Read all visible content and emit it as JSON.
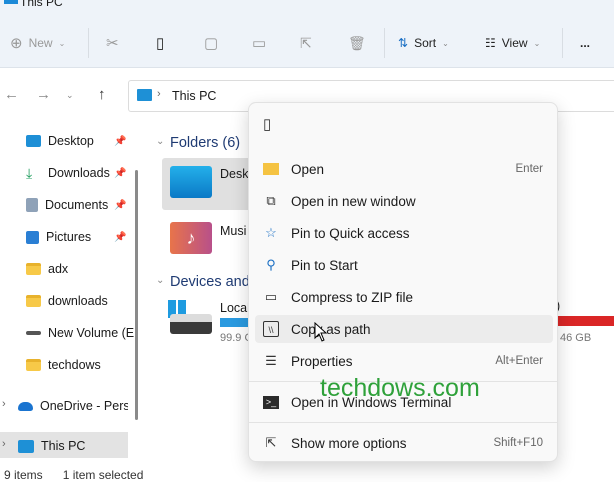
{
  "window": {
    "title": "This PC"
  },
  "toolbar": {
    "new": "New",
    "sort": "Sort",
    "view": "View",
    "more": "..."
  },
  "address": {
    "location": "This PC"
  },
  "sidebar": {
    "items": [
      {
        "label": "Desktop",
        "pinned": true
      },
      {
        "label": "Downloads",
        "pinned": true
      },
      {
        "label": "Documents",
        "pinned": true
      },
      {
        "label": "Pictures",
        "pinned": true
      },
      {
        "label": "adx"
      },
      {
        "label": "downloads"
      },
      {
        "label": "New Volume (E"
      },
      {
        "label": "techdows"
      }
    ],
    "onedrive": "OneDrive - Perso",
    "thispc": "This PC"
  },
  "main": {
    "folders_header": "Folders (6)",
    "folders": [
      "Deskt",
      "Musi"
    ],
    "devices_header": "Devices and",
    "drive": {
      "name": "Local",
      "free": "99.9 G",
      "usage_fraction": 0.4
    },
    "drive2": {
      "name_tail": ")",
      "free": "46 GB",
      "usage_fraction": 0.95,
      "bar_color": "#da2626"
    }
  },
  "context_menu": {
    "items": [
      {
        "label": "Open",
        "shortcut": "Enter"
      },
      {
        "label": "Open in new window"
      },
      {
        "label": "Pin to Quick access"
      },
      {
        "label": "Pin to Start"
      },
      {
        "label": "Compress to ZIP file"
      },
      {
        "label": "Copy as path"
      },
      {
        "label": "Properties",
        "shortcut": "Alt+Enter"
      },
      {
        "label": "Open in Windows Terminal"
      },
      {
        "label": "Show more options",
        "shortcut": "Shift+F10"
      }
    ]
  },
  "watermark": "techdows.com",
  "status": {
    "items": "9 items",
    "selected": "1 item selected"
  }
}
